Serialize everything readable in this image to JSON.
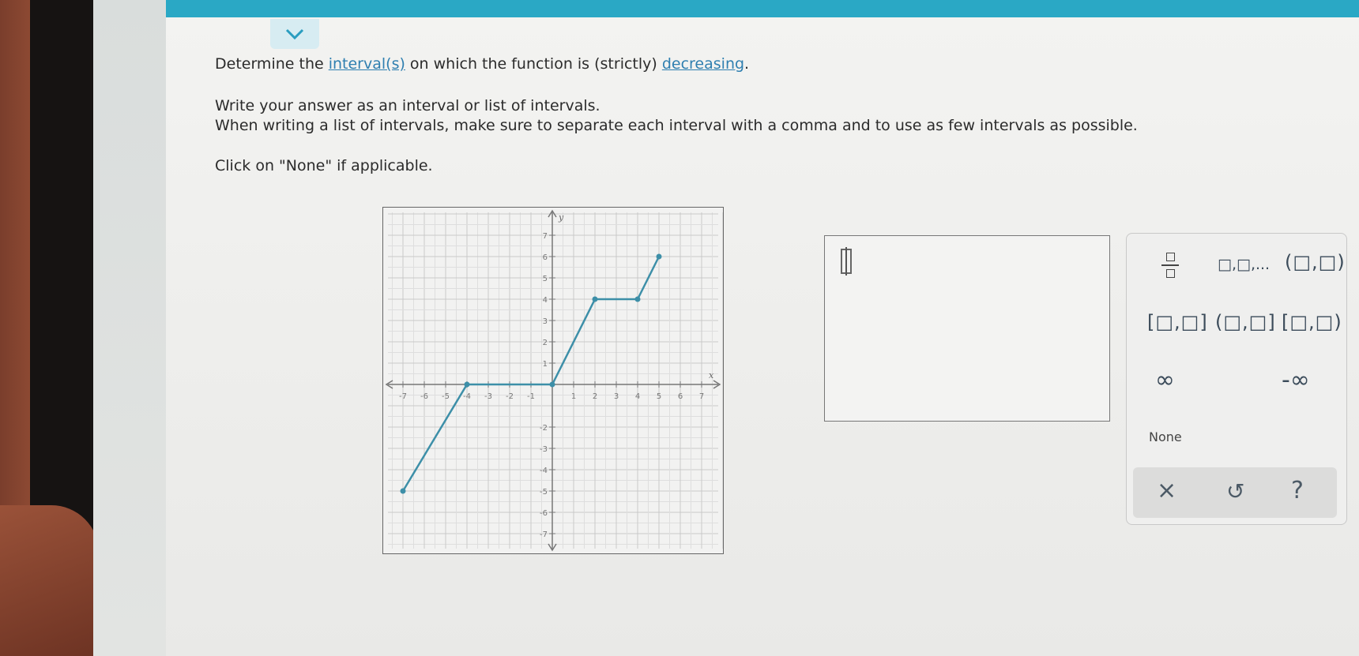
{
  "prompt": {
    "line1_prefix": "Determine the ",
    "line1_link1": "interval(s)",
    "line1_mid": " on which the function is (strictly) ",
    "line1_link2": "decreasing",
    "line1_suffix": ".",
    "line2": "Write your answer as an interval or list of intervals.",
    "line3": "When writing a list of intervals, make sure to separate each interval with a comma and to use as few intervals as possible.",
    "line4": "Click on \"None\" if applicable."
  },
  "graph": {
    "x_axis_label": "x",
    "y_axis_label": "y",
    "x_ticks": [
      "-7",
      "-6",
      "-5",
      "-4",
      "-3",
      "-2",
      "-1",
      "1",
      "2",
      "3",
      "4",
      "5",
      "6",
      "7"
    ],
    "y_ticks": [
      "7",
      "6",
      "5",
      "4",
      "3",
      "2",
      "1",
      "-2",
      "-3",
      "-4",
      "-5",
      "-6",
      "-7"
    ],
    "points": [
      [
        -7,
        -5
      ],
      [
        -4,
        0
      ],
      [
        0,
        0
      ],
      [
        2,
        4
      ],
      [
        4,
        4
      ],
      [
        5,
        6
      ]
    ],
    "line_color": "#3d8fa8"
  },
  "keypad": {
    "fraction_icon": "fraction-icon",
    "list_key": "□,□,...",
    "open_open": "(□,□)",
    "closed_closed": "[□,□]",
    "open_closed": "(□,□]",
    "closed_open": "[□,□)",
    "infinity": "∞",
    "neg_infinity": "-∞",
    "none": "None",
    "clear": "×",
    "undo": "↺",
    "help": "?"
  },
  "colors": {
    "accent": "#2aa8c5",
    "link": "#2f7fb0"
  }
}
